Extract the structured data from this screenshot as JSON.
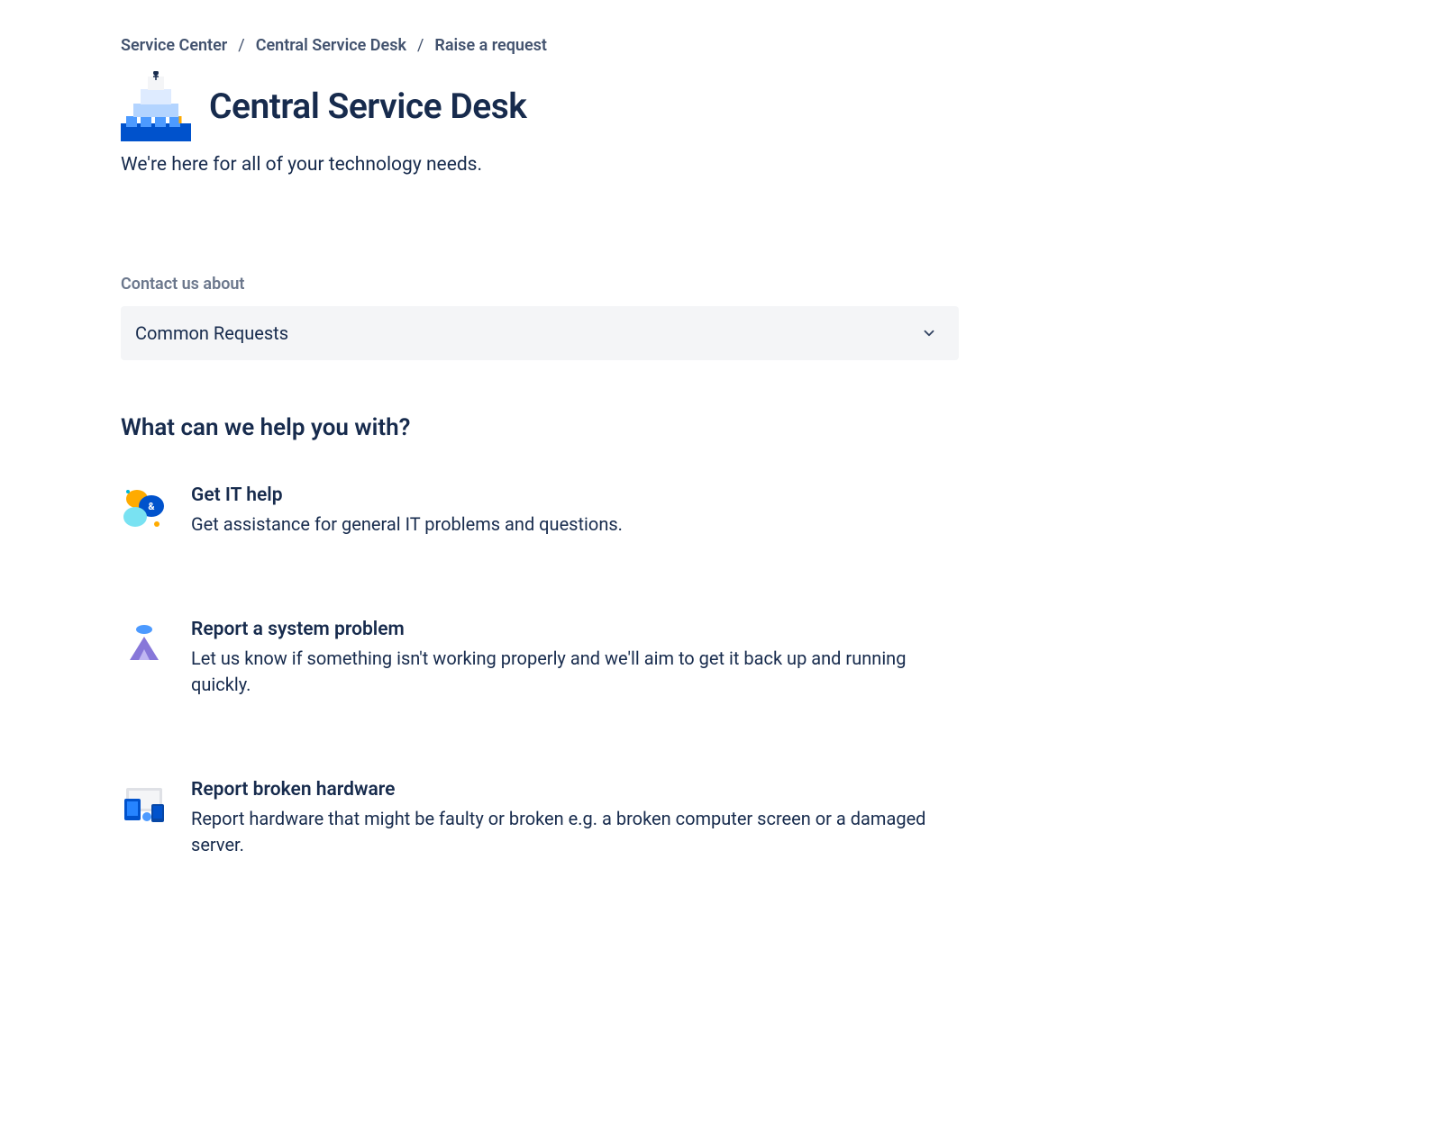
{
  "breadcrumb": {
    "items": [
      {
        "label": "Service Center"
      },
      {
        "label": "Central Service Desk"
      },
      {
        "label": "Raise a request"
      }
    ],
    "separator": "/"
  },
  "header": {
    "title": "Central Service Desk",
    "subtitle": "We're here for all of your technology needs."
  },
  "contact": {
    "label": "Contact us about",
    "selected": "Common Requests"
  },
  "help": {
    "heading": "What can we help you with?",
    "requests": [
      {
        "title": "Get IT help",
        "description": "Get assistance for general IT problems and questions.",
        "icon": "chat-bubbles-icon"
      },
      {
        "title": "Report a system problem",
        "description": "Let us know if something isn't working properly and we'll aim to get it back up and running quickly.",
        "icon": "mountain-flag-icon"
      },
      {
        "title": "Report broken hardware",
        "description": "Report hardware that might be faulty or broken e.g. a broken computer screen or a damaged server.",
        "icon": "devices-icon"
      }
    ]
  }
}
